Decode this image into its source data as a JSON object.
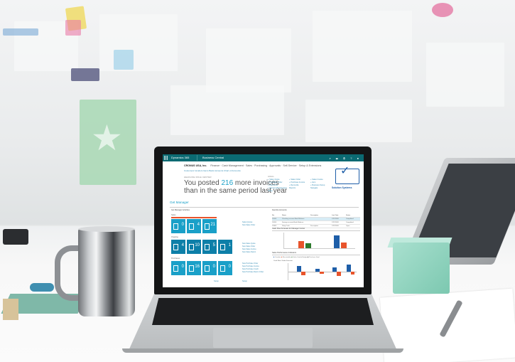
{
  "app": {
    "product": "Dynamics 365",
    "module": "Business Central",
    "top_icons": "⌕ ☰ ⚙ ? ●"
  },
  "nav": {
    "company": "CRONUS USA, Inc.",
    "items": [
      "Finance",
      "Cash Management",
      "Sales",
      "Purchasing",
      "Approvals",
      "Self-Service",
      "Setup & Extensions"
    ],
    "subnav": "Customers   Vendors   Items   Bank Accounts   Chart of Accounts"
  },
  "headline": {
    "tagline": "Headline   Role Center",
    "before": "You posted ",
    "number": "216",
    "after": " more invoices than in the same period last year"
  },
  "actions": {
    "title": "Actions",
    "items": [
      "+ Sales Quote",
      "+ Sales Order",
      "+ Sales Invoice",
      "+ Purchase Order",
      "+ Purchase Invoice",
      "+ Item",
      "+ Payments",
      "+ Reconcile",
      "+ Business Setup",
      "+ Service Management",
      "Reports",
      "Navigate",
      "Setup"
    ]
  },
  "logo": {
    "text": "Solution Systems",
    "colors": {
      "brand": "#1e5ea8"
    }
  },
  "section": {
    "title": "Get Manager"
  },
  "activities": {
    "panel_title": "Get Manager Activities",
    "groups": [
      {
        "label": "Sales",
        "tiles": [
          "0",
          "4",
          "21"
        ],
        "links": [
          "Sales Quotes",
          "New Sales Order"
        ]
      },
      {
        "label": "Ongoing",
        "tiles": [
          "4",
          "10",
          "5",
          "1"
        ],
        "links": [
          "New Sales Quote",
          "New Sales Order",
          "New Sales Invoice",
          "New Sales Return"
        ]
      },
      {
        "label": "Purchases",
        "tiles": [
          "0",
          "16",
          "0",
          "0"
        ],
        "links": [
          "New Purchase Order",
          "New Purchase Invoice",
          "New Purchase Credit",
          "New Purchase Return Order"
        ]
      }
    ],
    "footer": [
      "Setup",
      "Setup"
    ]
  },
  "favorites": {
    "title": "Favorite Accounts",
    "columns": [
      "No.",
      "Name",
      "Description",
      "Last Date",
      "Status"
    ],
    "rows": [
      [
        "10100",
        "Checking account Bank Balance",
        "",
        "1/21/2018",
        "Completed"
      ],
      [
        "10200",
        "Savings account Bank Balance",
        "",
        "1/21/2018",
        "Completed"
      ],
      [
        "10300",
        "Petty Cash",
        "Description",
        "1/22/2018",
        "Open"
      ]
    ]
  },
  "chart1": {
    "title": "Cash Flow Forecast for Manager Center",
    "labels": [
      "",
      ""
    ]
  },
  "chart2": {
    "title": "Sales Performance Indicators",
    "legend": [
      "Overdue",
      "Receivables",
      "Sales Goal",
      "Budget",
      "Purchase Goal"
    ],
    "subtitle": "Cash Flow / Sales Forecast",
    "x_labels": [
      "",
      "",
      "",
      ""
    ]
  }
}
